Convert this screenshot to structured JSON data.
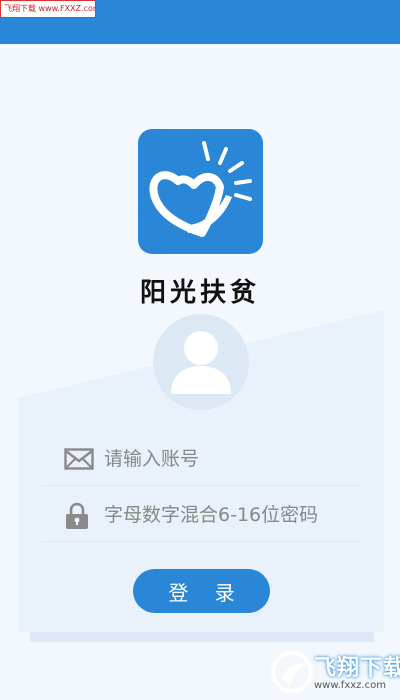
{
  "watermark_top": "飞翔下载 www.FXXZ.com",
  "app": {
    "title": "阳光扶贫"
  },
  "form": {
    "account_placeholder": "请输入账号",
    "password_placeholder": "字母数字混合6-16位密码",
    "login_label": "登 录"
  },
  "watermark_bottom": {
    "title": "飞翔下载",
    "url": "www.fxxz.com"
  },
  "icons": {
    "avatar": "user-silhouette-icon",
    "account": "mail-icon",
    "password": "lock-icon",
    "logo": "heart-sun-logo"
  },
  "colors": {
    "primary": "#2a86d6",
    "background": "#f2f8fd"
  }
}
